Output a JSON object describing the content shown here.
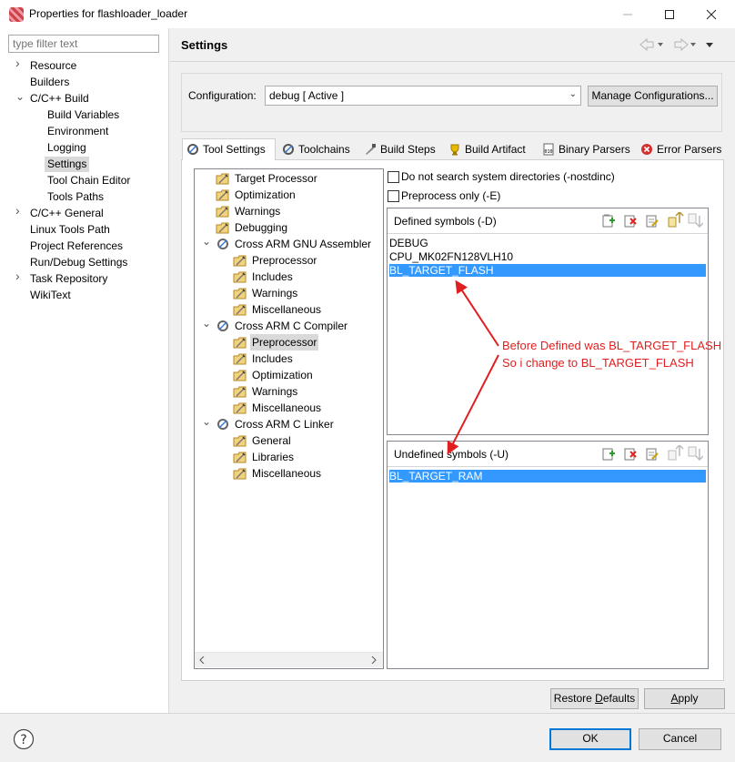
{
  "window": {
    "title": "Properties for flashloader_loader"
  },
  "filter": {
    "placeholder": "type filter text"
  },
  "nav_tree": [
    {
      "label": "Resource",
      "expand": "collapsed",
      "indent": 0
    },
    {
      "label": "Builders",
      "expand": "none",
      "indent": 0
    },
    {
      "label": "C/C++ Build",
      "expand": "expanded",
      "indent": 0
    },
    {
      "label": "Build Variables",
      "expand": "none",
      "indent": 1
    },
    {
      "label": "Environment",
      "expand": "none",
      "indent": 1
    },
    {
      "label": "Logging",
      "expand": "none",
      "indent": 1
    },
    {
      "label": "Settings",
      "expand": "none",
      "indent": 1,
      "selected": true
    },
    {
      "label": "Tool Chain Editor",
      "expand": "none",
      "indent": 1
    },
    {
      "label": "Tools Paths",
      "expand": "none",
      "indent": 1
    },
    {
      "label": "C/C++ General",
      "expand": "collapsed",
      "indent": 0
    },
    {
      "label": "Linux Tools Path",
      "expand": "none",
      "indent": 0
    },
    {
      "label": "Project References",
      "expand": "none",
      "indent": 0
    },
    {
      "label": "Run/Debug Settings",
      "expand": "none",
      "indent": 0
    },
    {
      "label": "Task Repository",
      "expand": "collapsed",
      "indent": 0
    },
    {
      "label": "WikiText",
      "expand": "none",
      "indent": 0
    }
  ],
  "header": {
    "title": "Settings"
  },
  "configuration": {
    "label": "Configuration:",
    "value": "debug  [ Active ]",
    "manage_label": "Manage Configurations..."
  },
  "tabs": [
    {
      "label": "Tool Settings",
      "icon": "tool-settings-icon",
      "active": true
    },
    {
      "label": "Toolchains",
      "icon": "toolchains-icon"
    },
    {
      "label": "Build Steps",
      "icon": "build-steps-icon"
    },
    {
      "label": "Build Artifact",
      "icon": "build-artifact-icon"
    },
    {
      "label": "Binary Parsers",
      "icon": "binary-parsers-icon"
    },
    {
      "label": "Error Parsers",
      "icon": "error-parsers-icon"
    }
  ],
  "tool_tree": [
    {
      "label": "Target Processor",
      "kind": "folder",
      "indent": 0
    },
    {
      "label": "Optimization",
      "kind": "folder",
      "indent": 0
    },
    {
      "label": "Warnings",
      "kind": "folder",
      "indent": 0
    },
    {
      "label": "Debugging",
      "kind": "folder",
      "indent": 0
    },
    {
      "label": "Cross ARM GNU Assembler",
      "kind": "tool",
      "indent": 0
    },
    {
      "label": "Preprocessor",
      "kind": "folder",
      "indent": 1
    },
    {
      "label": "Includes",
      "kind": "folder",
      "indent": 1
    },
    {
      "label": "Warnings",
      "kind": "folder",
      "indent": 1
    },
    {
      "label": "Miscellaneous",
      "kind": "folder",
      "indent": 1
    },
    {
      "label": "Cross ARM C Compiler",
      "kind": "tool",
      "indent": 0
    },
    {
      "label": "Preprocessor",
      "kind": "folder",
      "indent": 1,
      "selected": true
    },
    {
      "label": "Includes",
      "kind": "folder",
      "indent": 1
    },
    {
      "label": "Optimization",
      "kind": "folder",
      "indent": 1
    },
    {
      "label": "Warnings",
      "kind": "folder",
      "indent": 1
    },
    {
      "label": "Miscellaneous",
      "kind": "folder",
      "indent": 1
    },
    {
      "label": "Cross ARM C Linker",
      "kind": "tool",
      "indent": 0
    },
    {
      "label": "General",
      "kind": "folder",
      "indent": 1
    },
    {
      "label": "Libraries",
      "kind": "folder",
      "indent": 1
    },
    {
      "label": "Miscellaneous",
      "kind": "folder",
      "indent": 1
    }
  ],
  "options": {
    "nostdinc_label": "Do not search system directories (-nostdinc)",
    "nostdinc_checked": false,
    "preprocess_label": "Preprocess only (-E)",
    "preprocess_checked": false
  },
  "defined": {
    "title": "Defined symbols (-D)",
    "items": [
      "DEBUG",
      "CPU_MK02FN128VLH10",
      "BL_TARGET_FLASH"
    ],
    "selected_index": 2
  },
  "undefined": {
    "title": "Undefined symbols (-U)",
    "items": [
      "BL_TARGET_RAM"
    ],
    "selected_index": 0
  },
  "annotation": {
    "line1": "Before Defined was BL_TARGET_FLASH",
    "line2": "So i change to BL_TARGET_FLASH",
    "color": "#e02020"
  },
  "buttons": {
    "restore_pre": "Restore ",
    "restore_u": "D",
    "restore_post": "efaults",
    "apply_u": "A",
    "apply_post": "pply",
    "ok": "OK",
    "cancel": "Cancel"
  }
}
